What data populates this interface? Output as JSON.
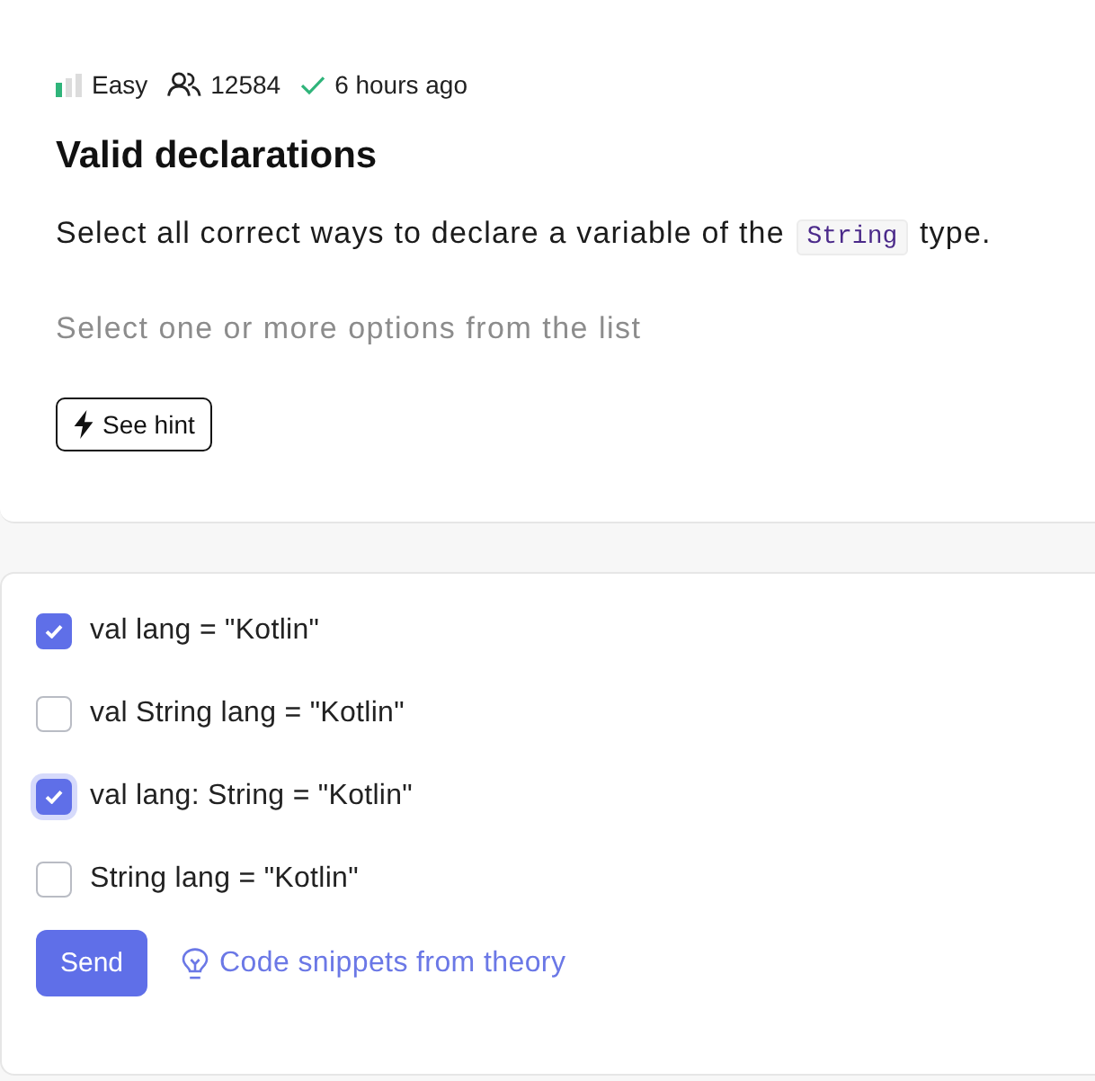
{
  "meta": {
    "difficulty": "Easy",
    "solved_count": "12584",
    "solved_time": "6 hours ago"
  },
  "title": "Valid declarations",
  "question": {
    "before": "Select all correct ways to declare a variable of the",
    "code": "String",
    "after": "type."
  },
  "instruction": "Select one or more options from the list",
  "hint_button": "See hint",
  "options": [
    {
      "label": "val lang = \"Kotlin\"",
      "checked": true,
      "focused": false
    },
    {
      "label": "val String lang = \"Kotlin\"",
      "checked": false,
      "focused": false
    },
    {
      "label": "val lang: String = \"Kotlin\"",
      "checked": true,
      "focused": true
    },
    {
      "label": "String lang = \"Kotlin\"",
      "checked": false,
      "focused": false
    }
  ],
  "send_button": "Send",
  "theory_link": "Code snippets from theory"
}
